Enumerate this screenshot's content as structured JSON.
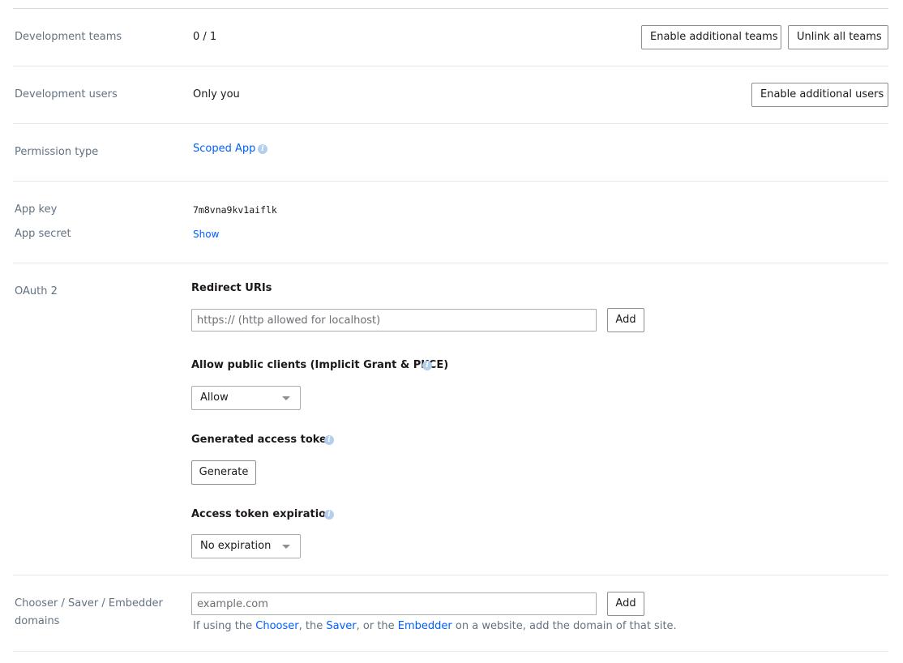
{
  "dev_teams": {
    "label": "Development teams",
    "value": "0 / 1",
    "enable_button": "Enable additional teams",
    "unlink_button": "Unlink all teams"
  },
  "dev_users": {
    "label": "Development users",
    "value": "Only you",
    "enable_button": "Enable additional users"
  },
  "permission": {
    "label": "Permission type",
    "value": "Scoped App",
    "info_icon": "info-icon"
  },
  "app_key": {
    "label": "App key",
    "value": "7m8vna9kv1aiflk"
  },
  "app_secret": {
    "label": "App secret",
    "show_link": "Show"
  },
  "oauth": {
    "label": "OAuth 2",
    "redirect_heading": "Redirect URIs",
    "redirect_placeholder": "https:// (http allowed for localhost)",
    "redirect_add": "Add",
    "public_clients_heading": "Allow public clients (Implicit Grant & PKCE)",
    "public_clients_value": "Allow",
    "token_heading": "Generated access token",
    "generate_button": "Generate",
    "expiration_heading": "Access token expiration",
    "expiration_value": "No expiration"
  },
  "domains": {
    "label_line1": "Chooser / Saver / Embedder",
    "label_line2": "domains",
    "placeholder": "example.com",
    "add_button": "Add",
    "help_prefix": "If using the",
    "chooser_link": "Chooser",
    "help_mid1": ", the",
    "saver_link": "Saver",
    "help_mid2": ", or the",
    "embedder_link": "Embedder",
    "help_suffix": "on a website, add the domain of that site."
  },
  "colors": {
    "link": "#0061fe",
    "label": "#637282",
    "info_icon": "#b4cfee"
  }
}
